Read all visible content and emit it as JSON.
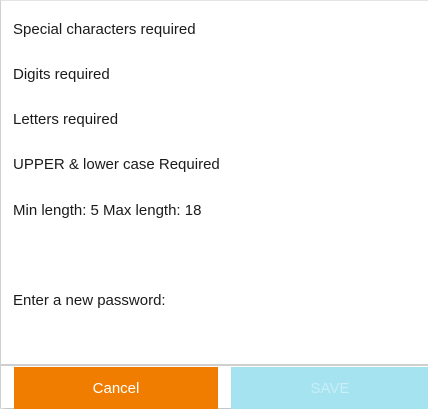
{
  "requirements": {
    "special": "Special characters required",
    "digits": "Digits required",
    "letters": "Letters required",
    "case": "UPPER & lower case Required",
    "length": "Min length: 5 Max length: 18"
  },
  "prompt": "Enter a new password:",
  "buttons": {
    "cancel_label": "Cancel",
    "save_label": "SAVE"
  },
  "colors": {
    "cancel_bg": "#f07d00",
    "save_bg_disabled": "#a5e3f0"
  }
}
